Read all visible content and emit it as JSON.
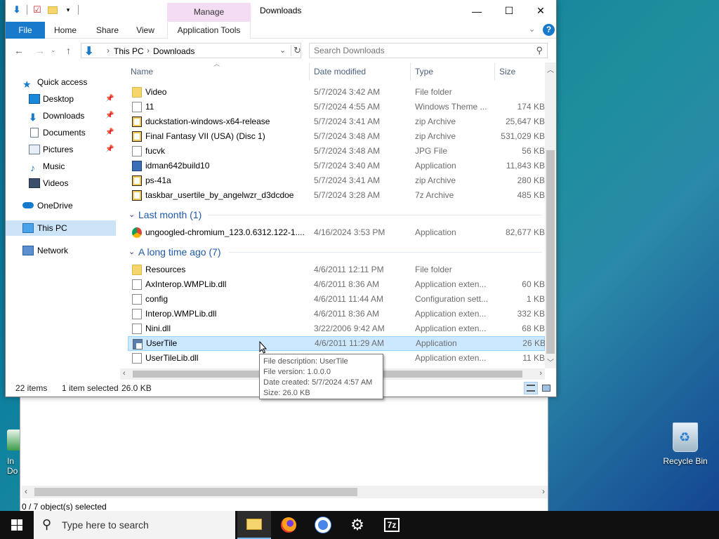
{
  "desktop": {
    "recycle_bin_label": "Recycle Bin",
    "partial_icon_label": "In\nDo"
  },
  "background_window": {
    "status": "0 / 7 object(s) selected"
  },
  "window": {
    "title": "Downloads",
    "context_tab_group": "Manage",
    "minimize": "—",
    "maximize": "☐",
    "close": "✕"
  },
  "ribbon": {
    "tabs": [
      "File",
      "Home",
      "Share",
      "View",
      "Application Tools"
    ],
    "help": "?"
  },
  "address": {
    "crumbs": [
      "This PC",
      "Downloads"
    ],
    "separator": "›"
  },
  "search": {
    "placeholder": "Search Downloads"
  },
  "nav_pane": [
    {
      "label": "Quick access",
      "icon": "star-icon",
      "pinned": false
    },
    {
      "label": "Desktop",
      "icon": "desktop-icon",
      "pinned": true
    },
    {
      "label": "Downloads",
      "icon": "download-arrow-icon",
      "pinned": true
    },
    {
      "label": "Documents",
      "icon": "documents-icon",
      "pinned": true
    },
    {
      "label": "Pictures",
      "icon": "pictures-icon",
      "pinned": true
    },
    {
      "label": "Music",
      "icon": "music-icon",
      "pinned": false
    },
    {
      "label": "Videos",
      "icon": "videos-icon",
      "pinned": false
    },
    {
      "label": "OneDrive",
      "icon": "cloud-icon",
      "pinned": false
    },
    {
      "label": "This PC",
      "icon": "computer-icon",
      "pinned": false,
      "selected": true
    },
    {
      "label": "Network",
      "icon": "network-icon",
      "pinned": false
    }
  ],
  "columns": [
    "Name",
    "Date modified",
    "Type",
    "Size"
  ],
  "groups": {
    "last_month": "Last month (1)",
    "long_ago": "A long time ago (7)"
  },
  "files_recent": [
    {
      "name": "Video",
      "date": "5/7/2024 3:42 AM",
      "type": "File folder",
      "size": "",
      "icon": "folder"
    },
    {
      "name": "11",
      "date": "5/7/2024 4:55 AM",
      "type": "Windows Theme ...",
      "size": "174 KB",
      "icon": "doc"
    },
    {
      "name": "duckstation-windows-x64-release",
      "date": "5/7/2024 3:41 AM",
      "type": "zip Archive",
      "size": "25,647 KB",
      "icon": "zip"
    },
    {
      "name": "Final Fantasy VII (USA) (Disc 1)",
      "date": "5/7/2024 3:48 AM",
      "type": "zip Archive",
      "size": "531,029 KB",
      "icon": "zip"
    },
    {
      "name": "fucvk",
      "date": "5/7/2024 3:48 AM",
      "type": "JPG File",
      "size": "56 KB",
      "icon": "doc"
    },
    {
      "name": "idman642build10",
      "date": "5/7/2024 3:40 AM",
      "type": "Application",
      "size": "11,843 KB",
      "icon": "app"
    },
    {
      "name": "ps-41a",
      "date": "5/7/2024 3:41 AM",
      "type": "zip Archive",
      "size": "280 KB",
      "icon": "zip"
    },
    {
      "name": "taskbar_usertile_by_angelwzr_d3dcdoe",
      "date": "5/7/2024 3:28 AM",
      "type": "7z Archive",
      "size": "485 KB",
      "icon": "zip"
    }
  ],
  "files_month": [
    {
      "name": "ungoogled-chromium_123.0.6312.122-1....",
      "date": "4/16/2024 3:53 PM",
      "type": "Application",
      "size": "82,677 KB",
      "icon": "chrome"
    }
  ],
  "files_old": [
    {
      "name": "Resources",
      "date": "4/6/2011 12:11 PM",
      "type": "File folder",
      "size": "",
      "icon": "folder"
    },
    {
      "name": "AxInterop.WMPLib.dll",
      "date": "4/6/2011 8:36 AM",
      "type": "Application exten...",
      "size": "60 KB",
      "icon": "doc"
    },
    {
      "name": "config",
      "date": "4/6/2011 11:44 AM",
      "type": "Configuration sett...",
      "size": "1 KB",
      "icon": "doc"
    },
    {
      "name": "Interop.WMPLib.dll",
      "date": "4/6/2011 8:36 AM",
      "type": "Application exten...",
      "size": "332 KB",
      "icon": "doc"
    },
    {
      "name": "Nini.dll",
      "date": "3/22/2006 9:42 AM",
      "type": "Application exten...",
      "size": "68 KB",
      "icon": "doc"
    },
    {
      "name": "UserTile",
      "date": "4/6/2011 11:29 AM",
      "type": "Application",
      "size": "26 KB",
      "icon": "tile",
      "selected": true
    },
    {
      "name": "UserTileLib.dll",
      "date": "",
      "type": "Application exten...",
      "size": "11 KB",
      "icon": "doc"
    }
  ],
  "status": {
    "items": "22 items",
    "selected": "1 item selected",
    "size": "26.0 KB"
  },
  "tooltip": {
    "lines": [
      "File description: UserTile",
      "File version: 1.0.0.0",
      "Date created: 5/7/2024 4:57 AM",
      "Size: 26.0 KB"
    ]
  },
  "taskbar": {
    "search_placeholder": "Type here to search",
    "apps": [
      "file-explorer",
      "firefox",
      "chromium",
      "settings",
      "7zip"
    ]
  }
}
